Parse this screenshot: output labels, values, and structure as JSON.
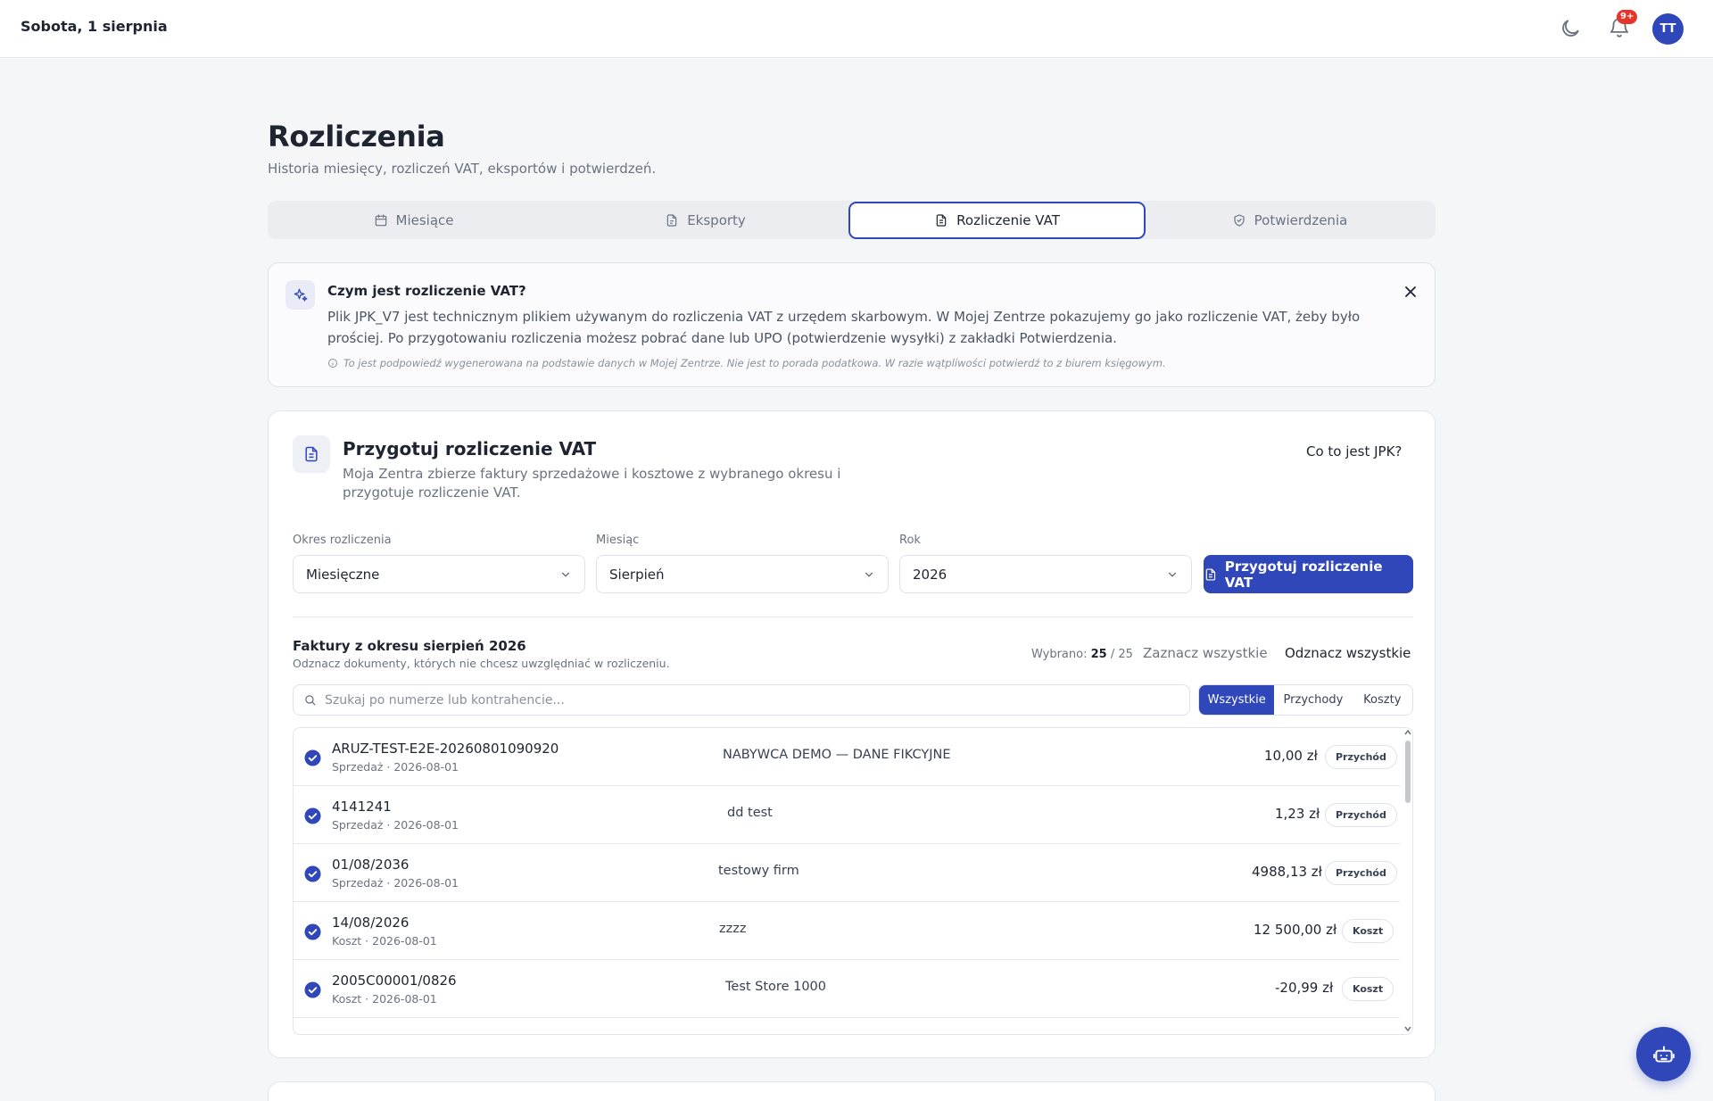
{
  "header": {
    "date": "Sobota, 1 sierpnia",
    "notifications_badge": "9+",
    "avatar_initials": "TT"
  },
  "page": {
    "title": "Rozliczenia",
    "subtitle": "Historia miesięcy, rozliczeń VAT, eksportów i potwierdzeń."
  },
  "tabs": [
    {
      "label": "Miesiące",
      "icon": "calendar-icon"
    },
    {
      "label": "Eksporty",
      "icon": "file-icon"
    },
    {
      "label": "Rozliczenie VAT",
      "icon": "document-icon",
      "active": true
    },
    {
      "label": "Potwierdzenia",
      "icon": "shield-check-icon"
    }
  ],
  "info_box": {
    "title": "Czym jest rozliczenie VAT?",
    "body": "Plik JPK_V7 jest technicznym plikiem używanym do rozliczenia VAT z urzędem skarbowym. W Mojej Zentrze pokazujemy go jako rozliczenie VAT, żeby było prościej. Po przygotowaniu rozliczenia możesz pobrać dane lub UPO (potwierdzenie wysyłki) z zakładki Potwierdzenia.",
    "note": "To jest podpowiedź wygenerowana na podstawie danych w Mojej Zentrze. Nie jest to porada podatkowa. W razie wątpliwości potwierdź to z biurem księgowym."
  },
  "prepare": {
    "title": "Przygotuj rozliczenie VAT",
    "description": "Moja Zentra zbierze faktury sprzedażowe i kosztowe z wybranego okresu i przygotuje rozliczenie VAT.",
    "help_link": "Co to jest JPK?",
    "period_label": "Okres rozliczenia",
    "period_value": "Miesięczne",
    "month_label": "Miesiąc",
    "month_value": "Sierpień",
    "year_label": "Rok",
    "year_value": "2026",
    "submit_label": "Przygotuj rozliczenie VAT"
  },
  "invoices": {
    "title": "Faktury z okresu sierpień 2026",
    "subtitle": "Odznacz dokumenty, których nie chcesz uwzględniać w rozliczeniu.",
    "selected_label": "Wybrano:",
    "selected_count": "25",
    "total_count": "/ 25",
    "select_all": "Zaznacz wszystkie",
    "deselect_all": "Odznacz wszystkie",
    "search_placeholder": "Szukaj po numerze lub kontrahencie...",
    "filters": [
      "Wszystkie",
      "Przychody",
      "Koszty"
    ],
    "active_filter": "Wszystkie",
    "rows": [
      {
        "number": "ARUZ-TEST-E2E-20260801090920",
        "meta": "Sprzedaż · 2026-08-01",
        "party": "NABYWCA DEMO — DANE FIKCYJNE",
        "amount": "10,00 zł",
        "tag": "Przychód"
      },
      {
        "number": "4141241",
        "meta": "Sprzedaż · 2026-08-01",
        "party": "dd test",
        "amount": "1,23 zł",
        "tag": "Przychód"
      },
      {
        "number": "01/08/2036",
        "meta": "Sprzedaż · 2026-08-01",
        "party": "testowy firm",
        "amount": "4988,13 zł",
        "tag": "Przychód"
      },
      {
        "number": "14/08/2026",
        "meta": "Koszt · 2026-08-01",
        "party": "zzzz",
        "amount": "12 500,00 zł",
        "tag": "Koszt"
      },
      {
        "number": "2005C00001/0826",
        "meta": "Koszt · 2026-08-01",
        "party": "Test Store 1000",
        "amount": "-20,99 zł",
        "tag": "Koszt"
      }
    ]
  },
  "colors": {
    "accent": "#2f47b8",
    "badge": "#e5352b",
    "page_bg": "#f5f6f8"
  }
}
